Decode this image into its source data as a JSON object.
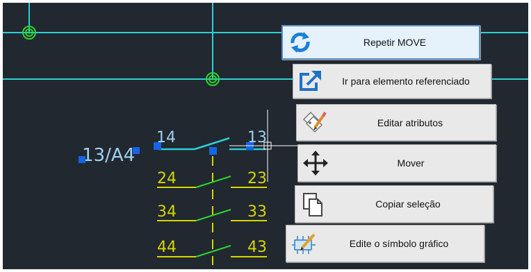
{
  "drawing": {
    "reference_label": "13/A4",
    "contacts": [
      {
        "left": "14",
        "right": "13"
      },
      {
        "left": "24",
        "right": "23"
      },
      {
        "left": "34",
        "right": "33"
      },
      {
        "left": "44",
        "right": "43"
      }
    ]
  },
  "context_menu": {
    "items": [
      {
        "label": "Repetir MOVE",
        "icon": "repeat-icon"
      },
      {
        "label": "Ir para elemento referenciado",
        "icon": "go-to-reference-icon"
      },
      {
        "label": "Editar atributos",
        "icon": "edit-attributes-icon"
      },
      {
        "label": "Mover",
        "icon": "move-icon"
      },
      {
        "label": "Copiar seleção",
        "icon": "copy-icon"
      },
      {
        "label": "Edite o símbolo gráfico",
        "icon": "edit-symbol-icon"
      }
    ]
  },
  "colors": {
    "canvas_bg": "#212830",
    "wire": "#2bd1d6",
    "node": "#2fd52f",
    "contact_text": "#d6d600",
    "grip": "#1565e8",
    "label_text": "#9fd0f0"
  }
}
